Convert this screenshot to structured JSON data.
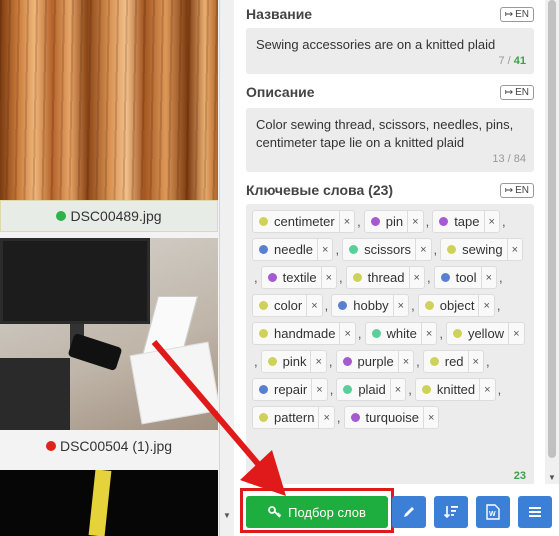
{
  "thumbnails": [
    {
      "filename": "DSC00489.jpg",
      "status_color": "#2db34a"
    },
    {
      "filename": "DSC00504 (1).jpg",
      "status_color": "#e0241b"
    }
  ],
  "title_section": {
    "label": "Название",
    "lang_button": "EN",
    "value": "Sewing accessories are on a knitted plaid",
    "counter_current": "7",
    "counter_sep": " / ",
    "counter_total": "41"
  },
  "description_section": {
    "label": "Описание",
    "lang_button": "EN",
    "value": "Color sewing thread, scissors, needles, pins, centimeter tape lie on a knitted plaid",
    "counter": "13 / 84"
  },
  "keywords_section": {
    "label": "Ключевые слова (23)",
    "lang_button": "EN",
    "count": "23",
    "tags": [
      {
        "text": "centimeter",
        "color": "#cfd25a"
      },
      {
        "text": "pin",
        "color": "#a45ad1"
      },
      {
        "text": "tape",
        "color": "#a45ad1"
      },
      {
        "text": "needle",
        "color": "#5a7fd1"
      },
      {
        "text": "scissors",
        "color": "#5acf9a"
      },
      {
        "text": "sewing",
        "color": "#cfd25a"
      },
      {
        "text": "textile",
        "color": "#a45ad1"
      },
      {
        "text": "thread",
        "color": "#cfd25a"
      },
      {
        "text": "tool",
        "color": "#5a7fd1"
      },
      {
        "text": "color",
        "color": "#cfd25a"
      },
      {
        "text": "hobby",
        "color": "#5a7fd1"
      },
      {
        "text": "object",
        "color": "#cfd25a"
      },
      {
        "text": "handmade",
        "color": "#cfd25a"
      },
      {
        "text": "white",
        "color": "#5acf9a"
      },
      {
        "text": "yellow",
        "color": "#cfd25a"
      },
      {
        "text": "pink",
        "color": "#cfd25a"
      },
      {
        "text": "purple",
        "color": "#a45ad1"
      },
      {
        "text": "red",
        "color": "#cfd25a"
      },
      {
        "text": "repair",
        "color": "#5a7fd1"
      },
      {
        "text": "plaid",
        "color": "#5acf9a"
      },
      {
        "text": "knitted",
        "color": "#cfd25a"
      },
      {
        "text": "pattern",
        "color": "#cfd25a"
      },
      {
        "text": "turquoise",
        "color": "#a45ad1"
      }
    ]
  },
  "toolbar": {
    "pick_words_label": "Подбор слов",
    "icons": [
      "key-icon",
      "pencil-icon",
      "sort-icon",
      "word-doc-icon",
      "menu-icon"
    ]
  },
  "colors": {
    "accent_green": "#1dae3f",
    "accent_blue": "#3b7fd6",
    "annotation_red": "#e01a1a"
  }
}
